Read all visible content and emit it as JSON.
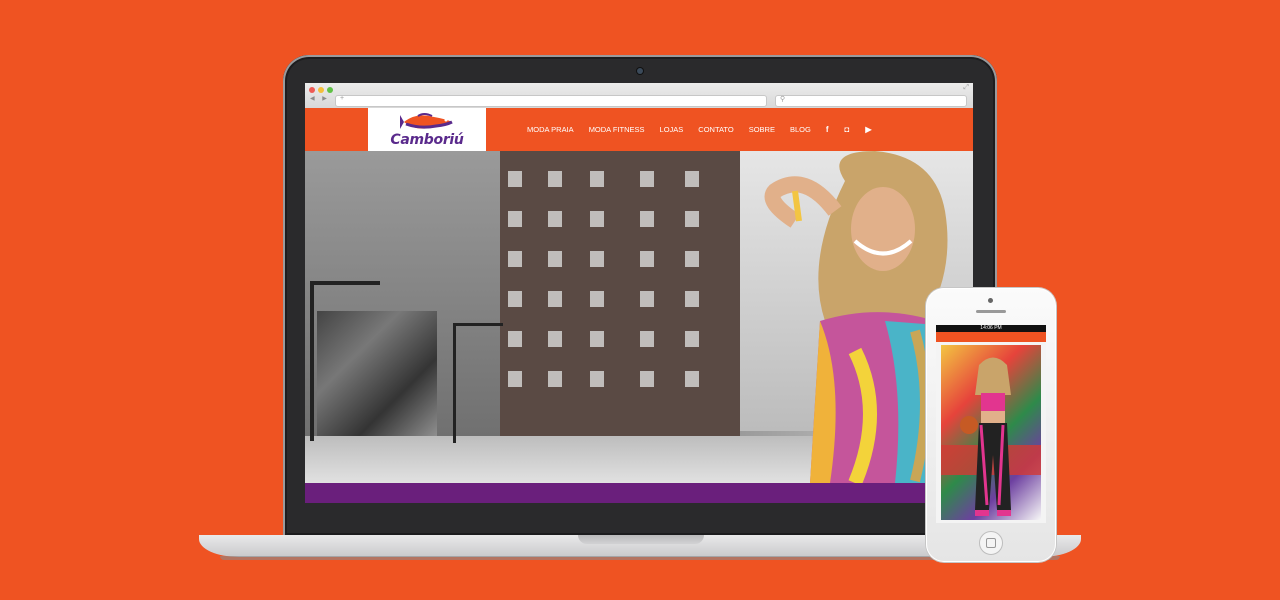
{
  "colors": {
    "background": "#ef5322",
    "brand_orange": "#ef5322",
    "brand_purple": "#6a1f7c"
  },
  "site": {
    "logo_text": "Camboriú",
    "nav": [
      "MODA PRAIA",
      "MODA FITNESS",
      "LOJAS",
      "CONTATO",
      "SOBRE",
      "BLOG"
    ],
    "social_icons": [
      {
        "name": "facebook-icon",
        "glyph": "f"
      },
      {
        "name": "instagram-icon",
        "glyph": "◘"
      },
      {
        "name": "youtube-icon",
        "glyph": "▶"
      }
    ]
  },
  "phone": {
    "status_time": "14:06 PM"
  }
}
